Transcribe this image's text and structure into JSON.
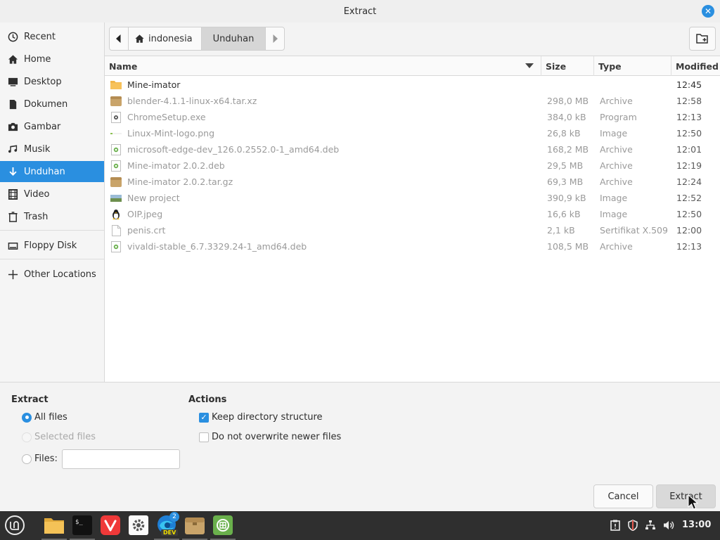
{
  "window": {
    "title": "Extract"
  },
  "sidebar": {
    "items": [
      {
        "label": "Recent",
        "icon": "clock-icon"
      },
      {
        "label": "Home",
        "icon": "home-icon"
      },
      {
        "label": "Desktop",
        "icon": "desktop-icon"
      },
      {
        "label": "Dokumen",
        "icon": "document-icon"
      },
      {
        "label": "Gambar",
        "icon": "camera-icon"
      },
      {
        "label": "Musik",
        "icon": "music-icon"
      },
      {
        "label": "Unduhan",
        "icon": "download-icon",
        "active": true
      },
      {
        "label": "Video",
        "icon": "video-icon"
      },
      {
        "label": "Trash",
        "icon": "trash-icon"
      },
      {
        "label": "Floppy Disk",
        "icon": "floppy-icon"
      },
      {
        "label": "Other Locations",
        "icon": "plus-icon"
      }
    ]
  },
  "pathbar": {
    "home_label": "indonesia",
    "current_label": "Unduhan"
  },
  "filelist": {
    "columns": {
      "name": "Name",
      "size": "Size",
      "type": "Type",
      "modified": "Modified"
    },
    "rows": [
      {
        "name": "Mine-imator",
        "size": "",
        "type": "",
        "modified": "12:45",
        "icon": "folder-icon"
      },
      {
        "name": "blender-4.1.1-linux-x64.tar.xz",
        "size": "298,0 MB",
        "type": "Archive",
        "modified": "12:58",
        "icon": "archive-icon"
      },
      {
        "name": "ChromeSetup.exe",
        "size": "384,0 kB",
        "type": "Program",
        "modified": "12:13",
        "icon": "program-icon"
      },
      {
        "name": "Linux-Mint-logo.png",
        "size": "26,8 kB",
        "type": "Image",
        "modified": "12:50",
        "icon": "image-icon"
      },
      {
        "name": "microsoft-edge-dev_126.0.2552.0-1_amd64.deb",
        "size": "168,2 MB",
        "type": "Archive",
        "modified": "12:01",
        "icon": "deb-icon"
      },
      {
        "name": "Mine-imator 2.0.2.deb",
        "size": "29,5 MB",
        "type": "Archive",
        "modified": "12:19",
        "icon": "deb-icon"
      },
      {
        "name": "Mine-imator 2.0.2.tar.gz",
        "size": "69,3 MB",
        "type": "Archive",
        "modified": "12:24",
        "icon": "archive-icon"
      },
      {
        "name": "New project",
        "size": "390,9 kB",
        "type": "Image",
        "modified": "12:52",
        "icon": "image-icon"
      },
      {
        "name": "OIP.jpeg",
        "size": "16,6 kB",
        "type": "Image",
        "modified": "12:50",
        "icon": "penguin-icon"
      },
      {
        "name": "penis.crt",
        "size": "2,1 kB",
        "type": "Sertifikat X.509",
        "modified": "12:00",
        "icon": "certificate-icon"
      },
      {
        "name": "vivaldi-stable_6.7.3329.24-1_amd64.deb",
        "size": "108,5 MB",
        "type": "Archive",
        "modified": "12:13",
        "icon": "deb-icon"
      }
    ]
  },
  "options": {
    "extract_heading": "Extract",
    "all_files": "All files",
    "selected_files": "Selected files",
    "files_label": "Files:",
    "files_value": "",
    "actions_heading": "Actions",
    "keep_dir": "Keep directory structure",
    "no_overwrite": "Do not overwrite newer files",
    "keep_dir_checked": true,
    "no_overwrite_checked": false
  },
  "buttons": {
    "cancel": "Cancel",
    "extract": "Extract"
  },
  "taskbar": {
    "apps": [
      "mint-menu-icon",
      "files-icon",
      "terminal-icon",
      "vivaldi-icon",
      "settings-icon",
      "edge-dev-icon",
      "archive-manager-icon",
      "spreadsheet-icon"
    ],
    "edge_badge": "2",
    "edge_dev_label": "DEV",
    "clock": "13:00"
  },
  "colors": {
    "accent": "#2a8fe0",
    "taskbar": "#2f2f2f"
  }
}
